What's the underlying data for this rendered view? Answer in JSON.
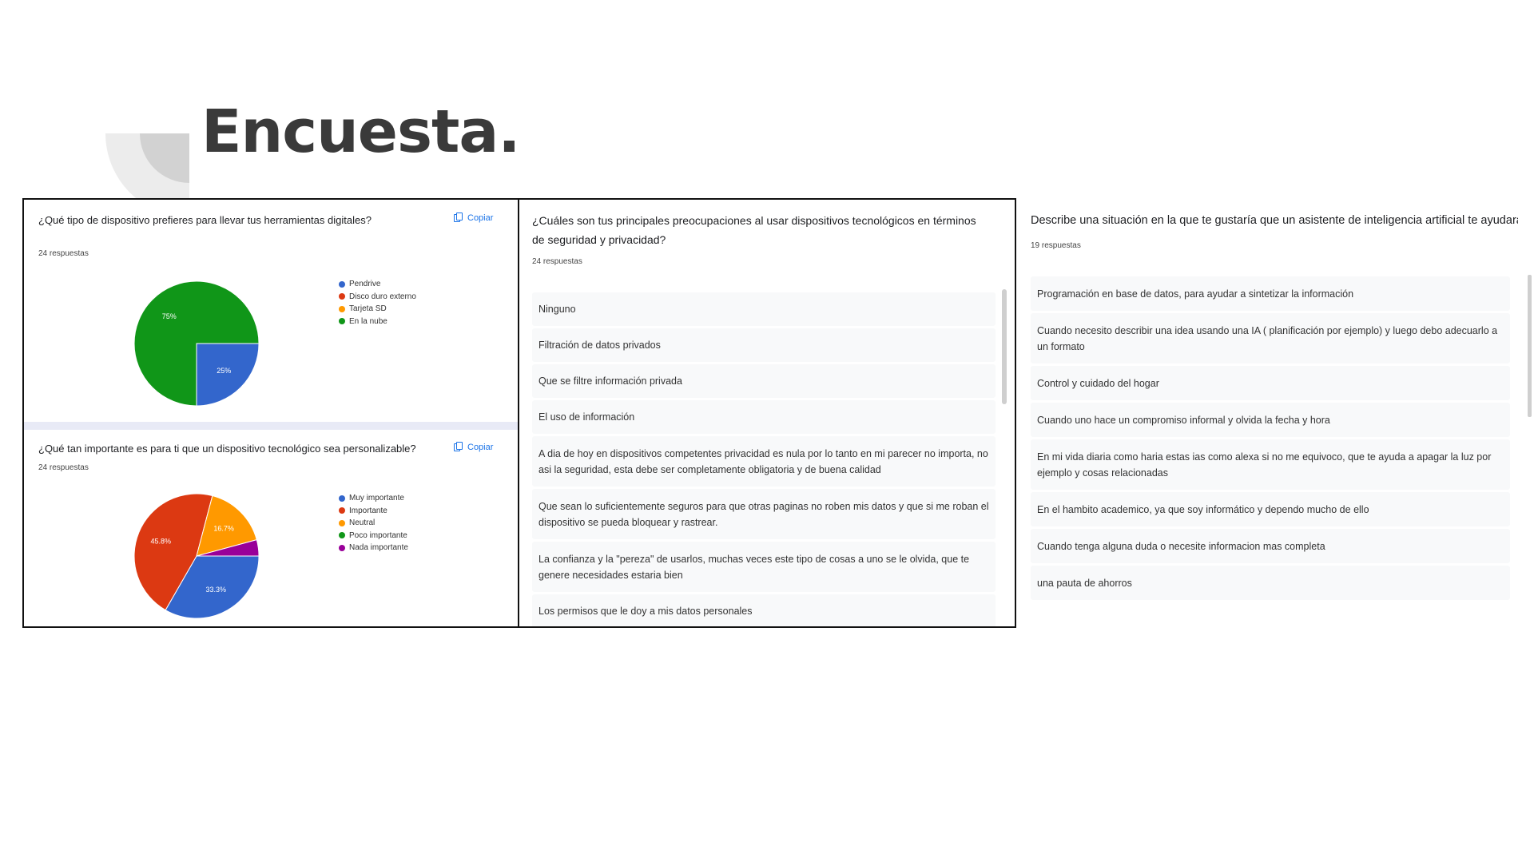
{
  "slide": {
    "title": "Encuesta."
  },
  "colors": {
    "blue": "#3366cc",
    "red": "#dc3912",
    "orange": "#ff9900",
    "green": "#109618",
    "purple": "#990099"
  },
  "left_panel": {
    "q1": {
      "title": "¿Qué tipo de dispositivo prefieres para llevar tus herramientas digitales?",
      "responses": "24 respuestas",
      "copy_label": "Copiar",
      "icon": "copy-icon"
    },
    "q2": {
      "title": "¿Qué tan importante es para ti que un dispositivo tecnológico sea personalizable?",
      "responses": "24 respuestas",
      "copy_label": "Copiar",
      "icon": "copy-icon"
    }
  },
  "chart_data": [
    {
      "type": "pie",
      "title": "¿Qué tipo de dispositivo prefieres para llevar tus herramientas digitales?",
      "categories": [
        "Pendrive",
        "Disco duro externo",
        "Tarjeta SD",
        "En la nube"
      ],
      "values": [
        25,
        0,
        0,
        75
      ],
      "value_labels": [
        "25%",
        "",
        "",
        "75%"
      ],
      "colors": [
        "#3366cc",
        "#dc3912",
        "#ff9900",
        "#109618"
      ],
      "legend_position": "right"
    },
    {
      "type": "pie",
      "title": "¿Qué tan importante es para ti que un dispositivo tecnológico sea personalizable?",
      "categories": [
        "Muy importante",
        "Importante",
        "Neutral",
        "Poco importante",
        "Nada importante"
      ],
      "values": [
        33.3,
        45.8,
        16.7,
        0,
        4.2
      ],
      "value_labels": [
        "33.3%",
        "45.8%",
        "16.7%",
        "",
        ""
      ],
      "colors": [
        "#3366cc",
        "#dc3912",
        "#ff9900",
        "#109618",
        "#990099"
      ],
      "legend_position": "right"
    }
  ],
  "middle_panel": {
    "title": "¿Cuáles son tus principales preocupaciones al usar dispositivos tecnológicos en términos de seguridad y privacidad?",
    "responses": "24 respuestas",
    "answers": [
      "Ninguno",
      "Filtración de datos privados",
      "Que se filtre información privada",
      "El uso de información",
      "A dia de hoy en dispositivos competentes privacidad es nula por lo tanto en mi parecer no importa, no asi la seguridad, esta debe ser completamente obligatoria y de buena calidad",
      "Que sean lo suficientemente seguros para que otras paginas no roben mis datos y que si me roban el dispositivo se pueda bloquear y rastrear.",
      "La confianza y la \"pereza\" de usarlos, muchas veces este tipo de cosas a uno se le olvida, que te genere necesidades estaria bien",
      "Los permisos que le doy a mis datos personales"
    ]
  },
  "right_panel": {
    "title": "Describe una situación en la que te gustaría que un asistente de inteligencia artificial te ayudara.",
    "responses": "19 respuestas",
    "answers": [
      "Programación en base de datos, para ayudar a sintetizar la información",
      "Cuando necesito describir una idea usando una IA ( planificación por ejemplo) y luego debo adecuarlo a un formato",
      "Control y cuidado del hogar",
      "Cuando uno hace un compromiso informal y olvida la fecha y hora",
      "En mi vida diaria como haria estas ias como alexa si no me equivoco, que te ayuda a apagar la luz por ejemplo y cosas relacionadas",
      "En el hambito academico, ya que soy informático y dependo mucho de ello",
      "Cuando tenga alguna duda o necesite informacion mas completa",
      "una pauta de ahorros"
    ]
  }
}
